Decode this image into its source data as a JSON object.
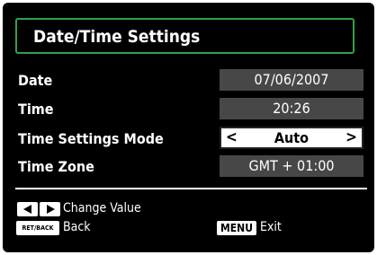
{
  "title": "Date/Time Settings",
  "rows": [
    {
      "label": "Date",
      "value": "07/06/2007"
    },
    {
      "label": "Time",
      "value": "20:26"
    },
    {
      "label": "Time Settings Mode",
      "value": "Auto"
    },
    {
      "label": "Time Zone",
      "value": "GMT + 01:00"
    }
  ],
  "footer": {
    "change_value": "Change Value",
    "back_key": "RET/BACK",
    "back_label": "Back",
    "menu_key": "MENU",
    "exit_label": "Exit"
  },
  "arrows": {
    "left": "<",
    "right": ">"
  },
  "colors": {
    "frame": "#000000",
    "title_border": "#34a04a",
    "value_bg": "#474747",
    "selected_bg": "#ffffff"
  }
}
